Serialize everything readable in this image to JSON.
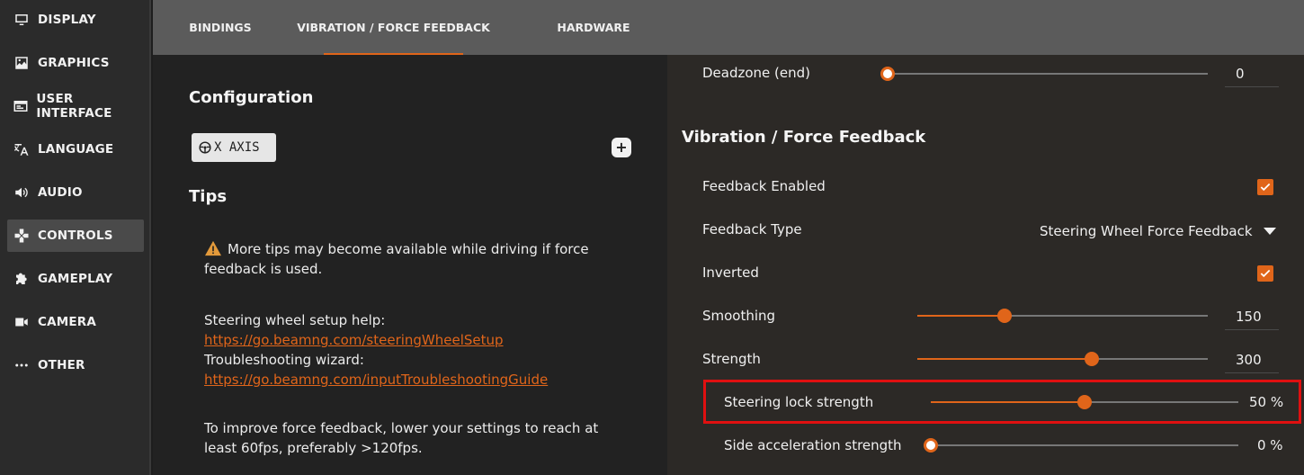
{
  "sidebar": {
    "items": [
      {
        "label": "DISPLAY",
        "icon": "monitor-icon"
      },
      {
        "label": "GRAPHICS",
        "icon": "image-icon"
      },
      {
        "label": "USER INTERFACE",
        "icon": "window-icon"
      },
      {
        "label": "LANGUAGE",
        "icon": "translate-icon"
      },
      {
        "label": "AUDIO",
        "icon": "speaker-icon"
      },
      {
        "label": "CONTROLS",
        "icon": "gamepad-icon",
        "active": true
      },
      {
        "label": "GAMEPLAY",
        "icon": "puzzle-icon"
      },
      {
        "label": "CAMERA",
        "icon": "camera-icon"
      },
      {
        "label": "OTHER",
        "icon": "dots-icon"
      }
    ]
  },
  "tabs": [
    {
      "label": "BINDINGS"
    },
    {
      "label": "VIBRATION / FORCE FEEDBACK",
      "active": true
    },
    {
      "label": "HARDWARE"
    }
  ],
  "left": {
    "configuration_title": "Configuration",
    "axis_chip": "X AXIS",
    "add_button": "+",
    "tips_title": "Tips",
    "tip1": "More tips may become available while driving if force feedback is used.",
    "setup_help_label": "Steering wheel setup help:",
    "setup_help_link": "https://go.beamng.com/steeringWheelSetup",
    "troubleshoot_label": "Troubleshooting wizard:",
    "troubleshoot_link": "https://go.beamng.com/inputTroubleshootingGuide",
    "tip2": "To improve force feedback, lower your settings to reach at least 60fps, preferably >120fps."
  },
  "right": {
    "deadzone": {
      "label": "Deadzone (end)",
      "value": "0",
      "fraction": 0.0
    },
    "section_title": "Vibration / Force Feedback",
    "feedback_enabled": {
      "label": "Feedback Enabled",
      "checked": true
    },
    "feedback_type": {
      "label": "Feedback Type",
      "value": "Steering Wheel Force Feedback"
    },
    "inverted": {
      "label": "Inverted",
      "checked": true
    },
    "smoothing": {
      "label": "Smoothing",
      "value": "150",
      "fraction": 0.3
    },
    "strength": {
      "label": "Strength",
      "value": "300",
      "fraction": 0.6
    },
    "steering_lock": {
      "label": "Steering lock strength",
      "value": "50 %",
      "fraction": 0.5
    },
    "side_accel": {
      "label": "Side acceleration strength",
      "value": "0 %",
      "fraction": 0.0
    }
  },
  "colors": {
    "accent": "#e0651a",
    "highlight": "#e01010"
  }
}
